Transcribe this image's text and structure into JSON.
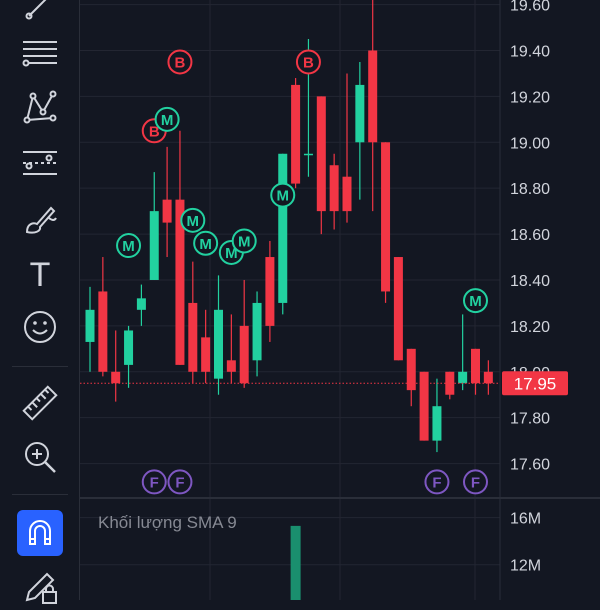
{
  "toolbar": {
    "items": [
      {
        "icon": "trend-line-icon"
      },
      {
        "icon": "horizontal-lines-icon"
      },
      {
        "icon": "pattern-icon"
      },
      {
        "icon": "forecast-icon"
      },
      {
        "icon": "brush-icon"
      },
      {
        "icon": "text-icon",
        "label": "T"
      },
      {
        "icon": "smiley-icon"
      },
      {
        "icon": "ruler-icon"
      },
      {
        "icon": "zoom-in-icon"
      },
      {
        "icon": "magnet-icon",
        "active": true
      },
      {
        "icon": "pencil-lock-icon"
      }
    ]
  },
  "volume_panel": {
    "label": "Khối lượng SMA 9",
    "axis_labels": [
      "16M",
      "12M"
    ]
  },
  "current_price": {
    "label": "17.95",
    "color": "#f23645"
  },
  "colors": {
    "up": "#22d1a0",
    "down": "#f23645",
    "signal_m": "#22d1a0",
    "signal_b": "#f23645",
    "signal_f": "#7e57c2",
    "active_tool": "#2962ff",
    "background": "#131722",
    "grid": "#232632"
  },
  "chart_data": {
    "type": "candlestick",
    "y_axis_labels": [
      "19.60",
      "19.40",
      "19.20",
      "19.00",
      "18.80",
      "18.60",
      "18.40",
      "18.20",
      "18.00",
      "17.80",
      "17.60"
    ],
    "ylim": [
      17.45,
      19.62
    ],
    "current_price": 17.95,
    "candles": [
      {
        "o": 18.13,
        "h": 18.37,
        "l": 18.0,
        "c": 18.27
      },
      {
        "o": 18.35,
        "h": 18.5,
        "l": 17.98,
        "c": 18.0
      },
      {
        "o": 18.0,
        "h": 18.18,
        "l": 17.87,
        "c": 17.95
      },
      {
        "o": 18.03,
        "h": 18.2,
        "l": 17.93,
        "c": 18.18
      },
      {
        "o": 18.27,
        "h": 18.38,
        "l": 18.2,
        "c": 18.32
      },
      {
        "o": 18.4,
        "h": 18.87,
        "l": 18.4,
        "c": 18.7
      },
      {
        "o": 18.75,
        "h": 18.98,
        "l": 18.5,
        "c": 18.65
      },
      {
        "o": 18.75,
        "h": 19.05,
        "l": 18.12,
        "c": 18.03
      },
      {
        "o": 18.3,
        "h": 18.48,
        "l": 17.95,
        "c": 18.0
      },
      {
        "o": 18.15,
        "h": 18.27,
        "l": 17.95,
        "c": 18.0
      },
      {
        "o": 17.97,
        "h": 18.42,
        "l": 17.9,
        "c": 18.27
      },
      {
        "o": 18.05,
        "h": 18.25,
        "l": 17.95,
        "c": 18.0
      },
      {
        "o": 18.2,
        "h": 18.4,
        "l": 17.93,
        "c": 17.95
      },
      {
        "o": 18.05,
        "h": 18.35,
        "l": 17.98,
        "c": 18.3
      },
      {
        "o": 18.5,
        "h": 18.57,
        "l": 18.13,
        "c": 18.2
      },
      {
        "o": 18.3,
        "h": 18.8,
        "l": 18.25,
        "c": 18.95
      },
      {
        "o": 19.25,
        "h": 19.28,
        "l": 18.8,
        "c": 18.82
      },
      {
        "o": 18.95,
        "h": 19.45,
        "l": 18.85,
        "c": 18.95
      },
      {
        "o": 19.2,
        "h": 19.2,
        "l": 18.6,
        "c": 18.7
      },
      {
        "o": 18.9,
        "h": 18.95,
        "l": 18.62,
        "c": 18.7
      },
      {
        "o": 18.85,
        "h": 19.3,
        "l": 18.65,
        "c": 18.7
      },
      {
        "o": 19.0,
        "h": 19.35,
        "l": 18.75,
        "c": 19.25
      },
      {
        "o": 19.4,
        "h": 19.65,
        "l": 18.7,
        "c": 19.0
      },
      {
        "o": 19.0,
        "h": 19.0,
        "l": 18.3,
        "c": 18.35
      },
      {
        "o": 18.5,
        "h": 18.5,
        "l": 18.05,
        "c": 18.05
      },
      {
        "o": 18.1,
        "h": 18.1,
        "l": 17.85,
        "c": 17.92
      },
      {
        "o": 18.0,
        "h": 18.0,
        "l": 17.75,
        "c": 17.7
      },
      {
        "o": 17.7,
        "h": 17.97,
        "l": 17.65,
        "c": 17.85
      },
      {
        "o": 18.0,
        "h": 18.0,
        "l": 17.88,
        "c": 17.9
      },
      {
        "o": 17.95,
        "h": 18.25,
        "l": 17.92,
        "c": 18.0
      },
      {
        "o": 18.1,
        "h": 18.1,
        "l": 17.9,
        "c": 17.95
      },
      {
        "o": 18.0,
        "h": 18.05,
        "l": 17.9,
        "c": 17.95
      }
    ],
    "signals": [
      {
        "label": "B",
        "candle": 7,
        "price": 19.35,
        "kind": "b"
      },
      {
        "label": "B",
        "candle": 17,
        "price": 19.35,
        "kind": "b"
      },
      {
        "label": "B",
        "candle": 5,
        "price": 19.05,
        "kind": "b"
      },
      {
        "label": "M",
        "candle": 6,
        "price": 19.1,
        "kind": "m"
      },
      {
        "label": "M",
        "candle": 3,
        "price": 18.55,
        "kind": "m"
      },
      {
        "label": "M",
        "candle": 8,
        "price": 18.66,
        "kind": "m"
      },
      {
        "label": "M",
        "candle": 9,
        "price": 18.56,
        "kind": "m"
      },
      {
        "label": "M",
        "candle": 11,
        "price": 18.52,
        "kind": "m"
      },
      {
        "label": "M",
        "candle": 12,
        "price": 18.57,
        "kind": "m"
      },
      {
        "label": "M",
        "candle": 15,
        "price": 18.77,
        "kind": "m"
      },
      {
        "label": "M",
        "candle": 30,
        "price": 18.31,
        "kind": "m"
      },
      {
        "label": "F",
        "candle": 5,
        "price": 17.52,
        "kind": "f"
      },
      {
        "label": "F",
        "candle": 7,
        "price": 17.52,
        "kind": "f"
      },
      {
        "label": "F",
        "candle": 27,
        "price": 17.52,
        "kind": "f"
      },
      {
        "label": "F",
        "candle": 30,
        "price": 17.52,
        "kind": "f"
      }
    ],
    "volume": {
      "ylim": [
        9000000,
        17500000
      ],
      "bars": [
        {
          "candle": 16,
          "value": 15300000
        }
      ]
    }
  }
}
